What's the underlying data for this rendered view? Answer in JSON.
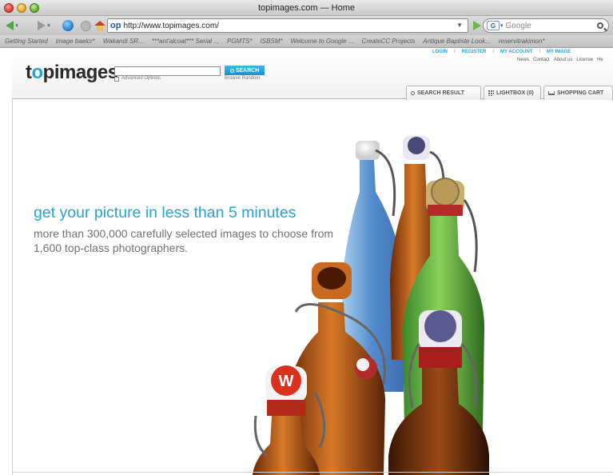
{
  "window": {
    "title": "topimages.com — Home"
  },
  "browser": {
    "url_prefix": "op",
    "url": "http://www.topimages.com/",
    "search_engine_badge": "G",
    "search_placeholder": "Google",
    "bookmarks": [
      "Getting Started",
      "image baelcr*",
      "Wakandi SR...",
      "***ant'alcoat*** Serial ...",
      "PGMTS*",
      "ISBSM*",
      "Welcome to Google ...",
      "CreateCC Projects",
      "Antique Baptiste Look...",
      "reservitrakimon*"
    ]
  },
  "site": {
    "logo": {
      "part1": "t",
      "part2": "o",
      "part3": "pimages"
    },
    "search": {
      "button_label": "SEARCH",
      "advanced_label": "Advanced Options",
      "browse_random": "Browse Random"
    },
    "top_links": {
      "login": "LOGIN",
      "register": "REGISTER",
      "my_account": "MY ACCOUNT",
      "my_images": "MY IMAGE",
      "separator": "I"
    },
    "sub_links": [
      "News",
      "Contact",
      "About us",
      "License",
      "He"
    ],
    "tabs": {
      "search_result": "SEARCH RESULT",
      "lightbox": "LIGHTBOX (0)",
      "shopping_cart": "SHOPPING CART"
    }
  },
  "hero": {
    "headline": "get your picture in less than 5 minutes",
    "subline": "more than 300,000 carefully selected images to choose from 1,600 top-class photographers.",
    "cap_letter": "W"
  },
  "colors": {
    "brand_blue": "#27a2d2",
    "text_gray": "#707070"
  }
}
